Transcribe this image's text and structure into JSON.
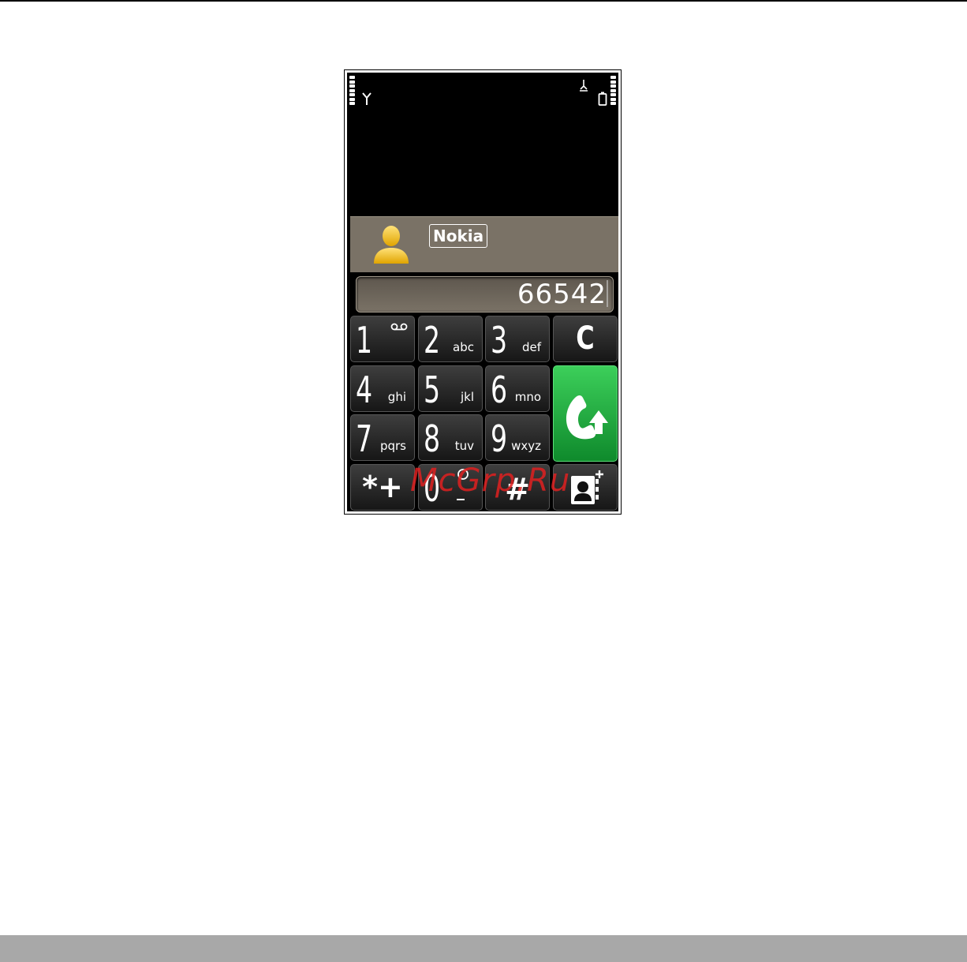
{
  "dialer": {
    "contact_name": "Nokia",
    "number": "66542",
    "keys": [
      {
        "digit": "1",
        "letters": ""
      },
      {
        "digit": "2",
        "letters": "abc"
      },
      {
        "digit": "3",
        "letters": "def"
      },
      {
        "digit": "4",
        "letters": "ghi"
      },
      {
        "digit": "5",
        "letters": "jkl"
      },
      {
        "digit": "6",
        "letters": "mno"
      },
      {
        "digit": "7",
        "letters": "pqrs"
      },
      {
        "digit": "8",
        "letters": "tuv"
      },
      {
        "digit": "9",
        "letters": "wxyz"
      },
      {
        "digit": "*+",
        "letters": ""
      },
      {
        "digit": "0",
        "letters": ""
      },
      {
        "digit": "#",
        "letters": ""
      }
    ],
    "clear_label": "C",
    "call_color": "#1fb043",
    "icons": [
      "signal-icon",
      "antenna-icon",
      "bluetooth-icon",
      "battery-icon",
      "voicemail-icon",
      "contact-avatar-icon",
      "call-icon",
      "add-contact-icon",
      "internet-call-icon"
    ]
  },
  "watermark": "McGrp.Ru"
}
